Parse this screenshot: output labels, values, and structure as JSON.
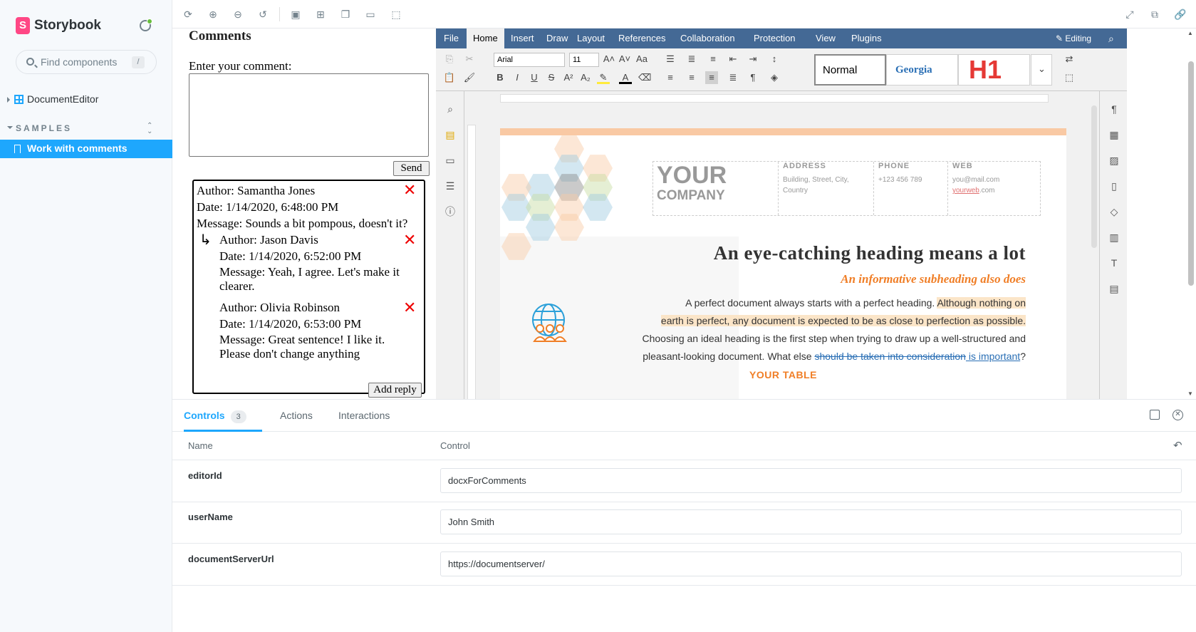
{
  "sidebar": {
    "title": "Storybook",
    "search_placeholder": "Find components",
    "search_shortcut": "/",
    "tree_item": "DocumentEditor",
    "section": "SAMPLES",
    "active_item": "Work with comments"
  },
  "preview": {
    "title": "Comments",
    "enter_label": "Enter your comment:",
    "send": "Send",
    "add_reply": "Add reply",
    "comments": [
      {
        "author": "Author: Samantha Jones",
        "date": "Date: 1/14/2020, 6:48:00 PM",
        "message": "Message: Sounds a bit pompous, doesn't it?"
      },
      {
        "author": "Author: Jason Davis",
        "date": "Date: 1/14/2020, 6:52:00 PM",
        "message1": "Message: Yeah, I agree. Let's make it",
        "message2": "clearer."
      },
      {
        "author": "Author: Olivia Robinson",
        "date": "Date: 1/14/2020, 6:53:00 PM",
        "message1": "Message: Great sentence! I like it.",
        "message2": "Please don't change anything"
      }
    ]
  },
  "editor": {
    "tabs": [
      "File",
      "Home",
      "Insert",
      "Draw",
      "Layout",
      "References",
      "Collaboration",
      "Protection",
      "View",
      "Plugins"
    ],
    "mode": "Editing",
    "font": "Arial",
    "size": "11",
    "styles": {
      "normal": "Normal",
      "georgia": "Georgia",
      "h1": "H1"
    },
    "page": {
      "your": "YOUR",
      "company": "COMPANY",
      "address_h": "ADDRESS",
      "address_v1": "Building, Street, City,",
      "address_v2": "Country",
      "phone_h": "PHONE",
      "phone_v": "+123 456 789",
      "web_h": "WEB",
      "web_v1": "you@mail.com",
      "web_v2a": "yourweb",
      "web_v2b": ".com",
      "heading": "An eye-catching heading means a lot",
      "subheading": "An informative subheading also does",
      "para_a": "A perfect document always starts with a perfect heading. ",
      "para_hl1": "Although nothing on",
      "para_hl2": "earth is perfect, any document is expected to be as close to perfection as possible.",
      "para_b": "Choosing an ideal heading is the first step when trying to draw up a well-structured and",
      "para_c": "pleasant-looking document. What else ",
      "para_strike": "should be taken into consideration",
      "para_link": " is important",
      "para_end": "?",
      "table_title": "YOUR TABLE"
    }
  },
  "addons": {
    "tabs": {
      "controls": "Controls",
      "controls_count": "3",
      "actions": "Actions",
      "interactions": "Interactions"
    },
    "headers": {
      "name": "Name",
      "control": "Control"
    },
    "rows": [
      {
        "name": "editorId",
        "value": "docxForComments"
      },
      {
        "name": "userName",
        "value": "John Smith"
      },
      {
        "name": "documentServerUrl",
        "value": "https://documentserver/"
      }
    ]
  },
  "colors": {
    "accent": "#1ea7fd",
    "brand": "#ff4785",
    "editor_header": "#446995",
    "orange": "#f07e26"
  }
}
